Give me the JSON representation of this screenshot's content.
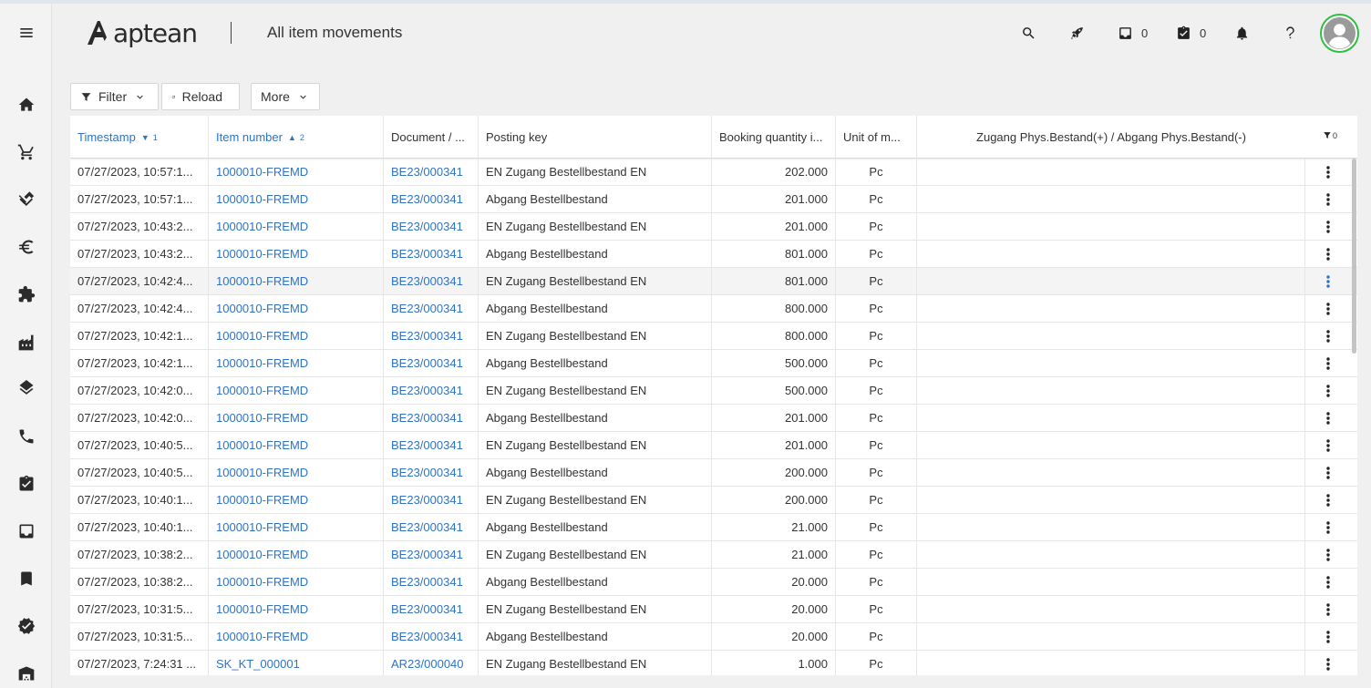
{
  "app": {
    "brand": "aptean",
    "page_title": "All item movements"
  },
  "sidebar": {
    "items": [
      {
        "icon": "hamburger-menu-icon"
      },
      {
        "icon": "home-icon"
      },
      {
        "icon": "cart-icon"
      },
      {
        "icon": "handshake-icon"
      },
      {
        "icon": "euro-icon"
      },
      {
        "icon": "puzzle-icon"
      },
      {
        "icon": "factory-icon"
      },
      {
        "icon": "layers-icon"
      },
      {
        "icon": "phone-icon"
      },
      {
        "icon": "task-icon"
      },
      {
        "icon": "inbox-icon"
      },
      {
        "icon": "bookmark-icon"
      },
      {
        "icon": "verified-badge-icon"
      },
      {
        "icon": "warehouse-icon"
      }
    ]
  },
  "header": {
    "inbox_count": "0",
    "tasks_count": "0"
  },
  "toolbar": {
    "filter_label": "Filter",
    "reload_label": "Reload",
    "more_label": "More"
  },
  "grid": {
    "columns": {
      "timestamp": "Timestamp",
      "timestamp_sort": "1",
      "item_number": "Item number",
      "item_number_sort": "2",
      "document": "Document / ...",
      "posting_key": "Posting key",
      "booking_qty": "Booking quantity i...",
      "unit": "Unit of m...",
      "zugang": "Zugang Phys.Bestand(+) / Abgang Phys.Bestand(-)",
      "filter_count": "0"
    },
    "rows": [
      {
        "ts": "07/27/2023, 10:57:1...",
        "item": "1000010-FREMD",
        "doc": "BE23/000341",
        "key": "EN Zugang Bestellbestand EN",
        "qty": "202.000",
        "unit": "Pc",
        "zug": ""
      },
      {
        "ts": "07/27/2023, 10:57:1...",
        "item": "1000010-FREMD",
        "doc": "BE23/000341",
        "key": "Abgang Bestellbestand",
        "qty": "201.000",
        "unit": "Pc",
        "zug": ""
      },
      {
        "ts": "07/27/2023, 10:43:2...",
        "item": "1000010-FREMD",
        "doc": "BE23/000341",
        "key": "EN Zugang Bestellbestand EN",
        "qty": "201.000",
        "unit": "Pc",
        "zug": ""
      },
      {
        "ts": "07/27/2023, 10:43:2...",
        "item": "1000010-FREMD",
        "doc": "BE23/000341",
        "key": "Abgang Bestellbestand",
        "qty": "801.000",
        "unit": "Pc",
        "zug": ""
      },
      {
        "ts": "07/27/2023, 10:42:4...",
        "item": "1000010-FREMD",
        "doc": "BE23/000341",
        "key": "EN Zugang Bestellbestand EN",
        "qty": "801.000",
        "unit": "Pc",
        "zug": ""
      },
      {
        "ts": "07/27/2023, 10:42:4...",
        "item": "1000010-FREMD",
        "doc": "BE23/000341",
        "key": "Abgang Bestellbestand",
        "qty": "800.000",
        "unit": "Pc",
        "zug": ""
      },
      {
        "ts": "07/27/2023, 10:42:1...",
        "item": "1000010-FREMD",
        "doc": "BE23/000341",
        "key": "EN Zugang Bestellbestand EN",
        "qty": "800.000",
        "unit": "Pc",
        "zug": ""
      },
      {
        "ts": "07/27/2023, 10:42:1...",
        "item": "1000010-FREMD",
        "doc": "BE23/000341",
        "key": "Abgang Bestellbestand",
        "qty": "500.000",
        "unit": "Pc",
        "zug": ""
      },
      {
        "ts": "07/27/2023, 10:42:0...",
        "item": "1000010-FREMD",
        "doc": "BE23/000341",
        "key": "EN Zugang Bestellbestand EN",
        "qty": "500.000",
        "unit": "Pc",
        "zug": ""
      },
      {
        "ts": "07/27/2023, 10:42:0...",
        "item": "1000010-FREMD",
        "doc": "BE23/000341",
        "key": "Abgang Bestellbestand",
        "qty": "201.000",
        "unit": "Pc",
        "zug": ""
      },
      {
        "ts": "07/27/2023, 10:40:5...",
        "item": "1000010-FREMD",
        "doc": "BE23/000341",
        "key": "EN Zugang Bestellbestand EN",
        "qty": "201.000",
        "unit": "Pc",
        "zug": ""
      },
      {
        "ts": "07/27/2023, 10:40:5...",
        "item": "1000010-FREMD",
        "doc": "BE23/000341",
        "key": "Abgang Bestellbestand",
        "qty": "200.000",
        "unit": "Pc",
        "zug": ""
      },
      {
        "ts": "07/27/2023, 10:40:1...",
        "item": "1000010-FREMD",
        "doc": "BE23/000341",
        "key": "EN Zugang Bestellbestand EN",
        "qty": "200.000",
        "unit": "Pc",
        "zug": ""
      },
      {
        "ts": "07/27/2023, 10:40:1...",
        "item": "1000010-FREMD",
        "doc": "BE23/000341",
        "key": "Abgang Bestellbestand",
        "qty": "21.000",
        "unit": "Pc",
        "zug": ""
      },
      {
        "ts": "07/27/2023, 10:38:2...",
        "item": "1000010-FREMD",
        "doc": "BE23/000341",
        "key": "EN Zugang Bestellbestand EN",
        "qty": "21.000",
        "unit": "Pc",
        "zug": ""
      },
      {
        "ts": "07/27/2023, 10:38:2...",
        "item": "1000010-FREMD",
        "doc": "BE23/000341",
        "key": "Abgang Bestellbestand",
        "qty": "20.000",
        "unit": "Pc",
        "zug": ""
      },
      {
        "ts": "07/27/2023, 10:31:5...",
        "item": "1000010-FREMD",
        "doc": "BE23/000341",
        "key": "EN Zugang Bestellbestand EN",
        "qty": "20.000",
        "unit": "Pc",
        "zug": ""
      },
      {
        "ts": "07/27/2023, 10:31:5...",
        "item": "1000010-FREMD",
        "doc": "BE23/000341",
        "key": "Abgang Bestellbestand",
        "qty": "20.000",
        "unit": "Pc",
        "zug": ""
      },
      {
        "ts": "07/27/2023, 7:24:31 ...",
        "item": "SK_KT_000001",
        "doc": "AR23/000040",
        "key": "EN Zugang Bestellbestand EN",
        "qty": "1.000",
        "unit": "Pc",
        "zug": ""
      }
    ]
  },
  "colors": {
    "link": "#2f73c2",
    "avatar_ring": "#2bc13f",
    "hover_row": "#f4f4f4"
  }
}
